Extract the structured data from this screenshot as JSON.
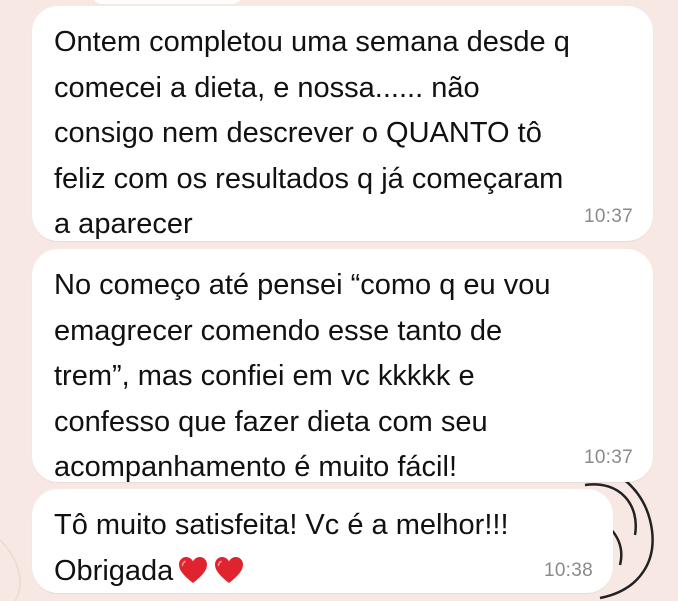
{
  "messages": [
    {
      "text": "Ontem completou uma semana desde q\ncomecei a dieta, e nossa...... não\nconsigo nem descrever o QUANTO tô\nfeliz com os resultados q já começaram\na aparecer",
      "time": "10:37"
    },
    {
      "text": "No começo até pensei “como q eu vou\nemagrecer comendo esse tanto de\ntrem”, mas confiei em vc kkkkk e\nconfesso que fazer dieta com seu\nacompanhamento é muito fácil!",
      "time": "10:37"
    },
    {
      "text": "Tô muito satisfeita! Vc é a melhor!!!\nObrigada",
      "emoji": [
        "red-heart",
        "red-heart"
      ],
      "time": "10:38"
    }
  ],
  "colors": {
    "wallpaper": "#f7e8e4",
    "bubble": "#ffffff",
    "text": "#111111",
    "timestamp": "#8a8a8a",
    "heart": "#e0242f"
  }
}
